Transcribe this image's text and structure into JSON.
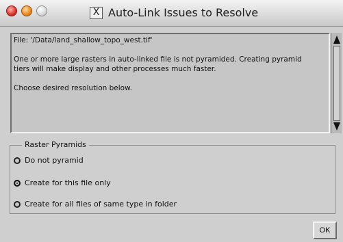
{
  "window": {
    "title": "Auto-Link Issues to Resolve",
    "logo_text": "X"
  },
  "message": {
    "file_line": "File: '/Data/land_shallow_topo_west.tif'",
    "paragraph1": "One or more large rasters in auto-linked file is not pyramided.  Creating pyramid tiers will make display and other processes much faster.",
    "paragraph2": "Choose desired resolution below."
  },
  "raster_pyramids": {
    "legend": "Raster Pyramids",
    "options": [
      {
        "label": "Do not pyramid",
        "selected": false
      },
      {
        "label": "Create for this file only",
        "selected": true
      },
      {
        "label": "Create for all files of same type in folder",
        "selected": false
      }
    ]
  },
  "buttons": {
    "ok_label": "OK"
  }
}
